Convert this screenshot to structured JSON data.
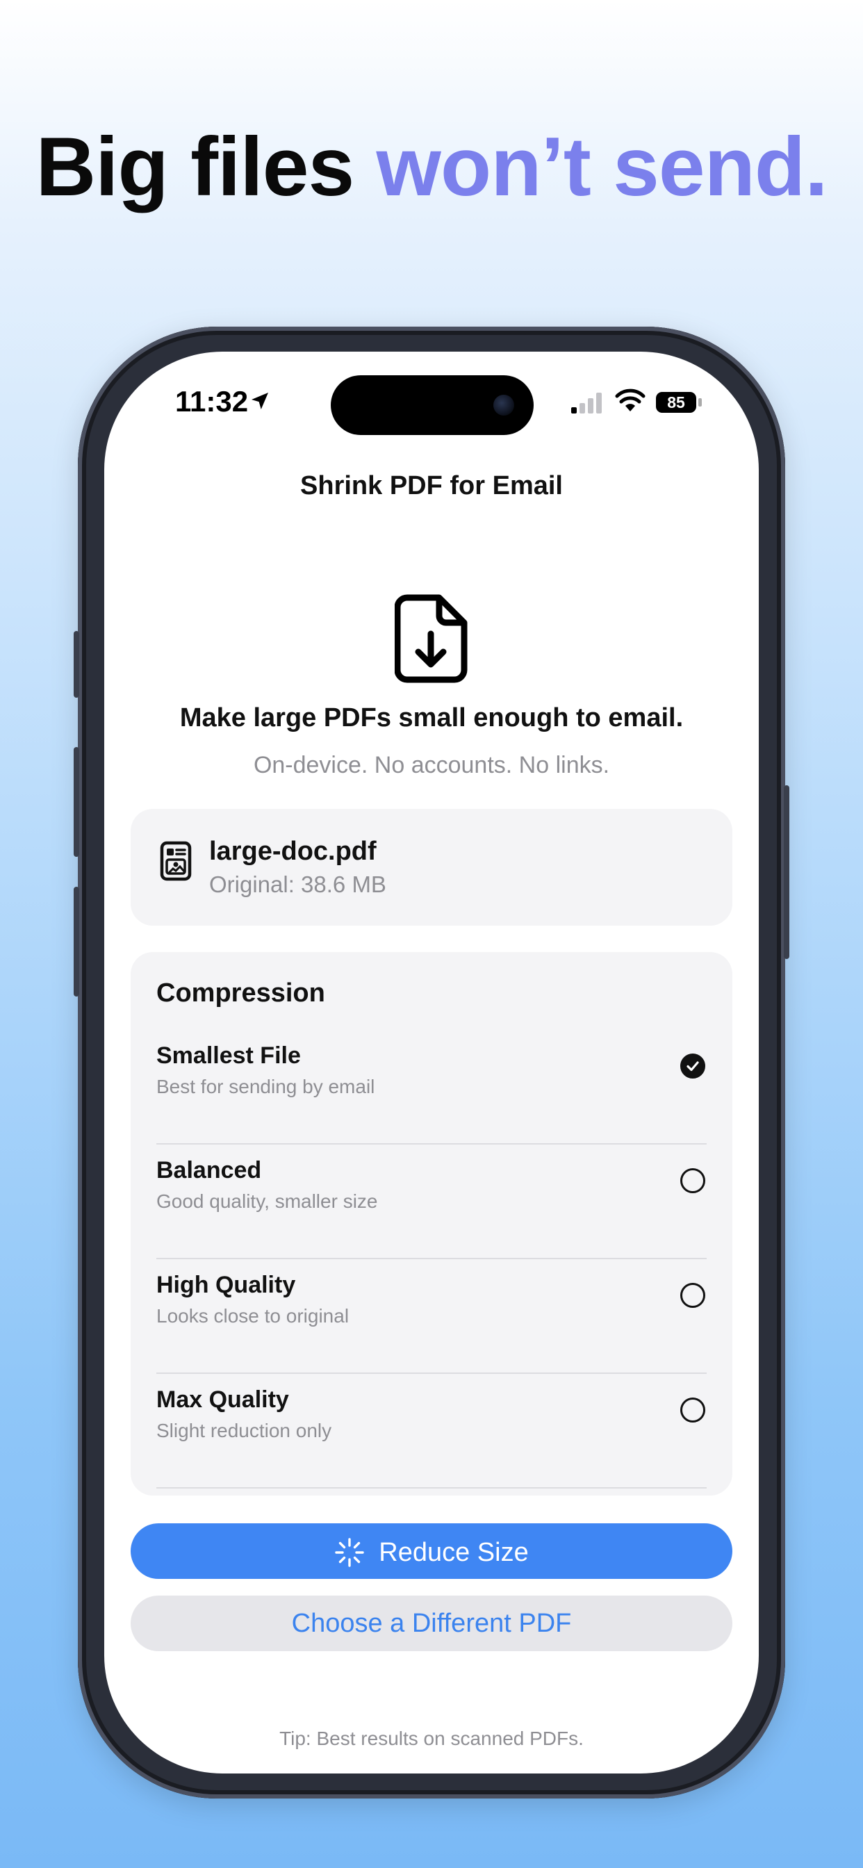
{
  "headline": {
    "part1": "Big files",
    "part2": "won’t send."
  },
  "status_bar": {
    "time": "11:32",
    "battery": "85"
  },
  "nav": {
    "title": "Shrink PDF for Email"
  },
  "hero": {
    "icon": "document-download-icon",
    "title": "Make large PDFs small enough to email.",
    "subtitle": "On-device. No accounts. No links."
  },
  "file": {
    "name": "large-doc.pdf",
    "size": "Original: 38.6 MB"
  },
  "compression": {
    "title": "Compression",
    "options": [
      {
        "name": "Smallest File",
        "desc": "Best for sending by email",
        "selected": true
      },
      {
        "name": "Balanced",
        "desc": "Good quality, smaller size",
        "selected": false
      },
      {
        "name": "High Quality",
        "desc": "Looks close to original",
        "selected": false
      },
      {
        "name": "Max Quality",
        "desc": "Slight reduction only",
        "selected": false
      }
    ]
  },
  "actions": {
    "primary": "Reduce Size",
    "secondary": "Choose a Different PDF"
  },
  "tip": "Tip: Best results on scanned PDFs.",
  "colors": {
    "accent": "#3f86f3",
    "headline_accent": "#7b80ec",
    "link": "#3b83ee"
  }
}
